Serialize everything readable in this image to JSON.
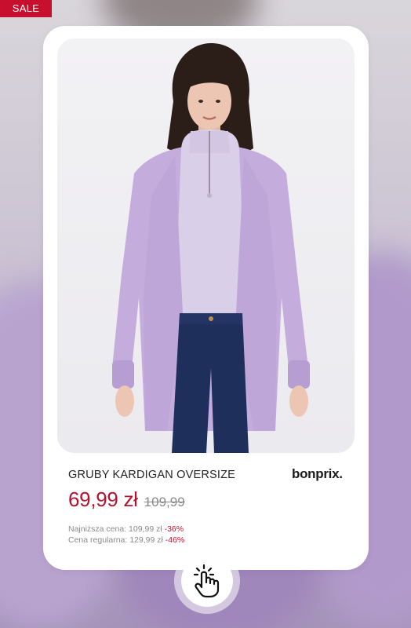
{
  "badge": {
    "label": "SALE"
  },
  "product": {
    "title": "GRUBY KARDIGAN OVERSIZE",
    "brand": "bonprix.",
    "price_current": "69,99 zł",
    "price_old": "109,99"
  },
  "price_notes": [
    {
      "label": "Najniższa cena: 109,99 zł ",
      "discount": "-36%"
    },
    {
      "label": "Cena regularna: 129,99 zł ",
      "discount": "-46%"
    }
  ],
  "colors": {
    "sale_red": "#c8102e",
    "price_red": "#b5122f",
    "cardigan_lilac": "#c4addd"
  },
  "icons": {
    "tap": "hand-tap-icon"
  }
}
